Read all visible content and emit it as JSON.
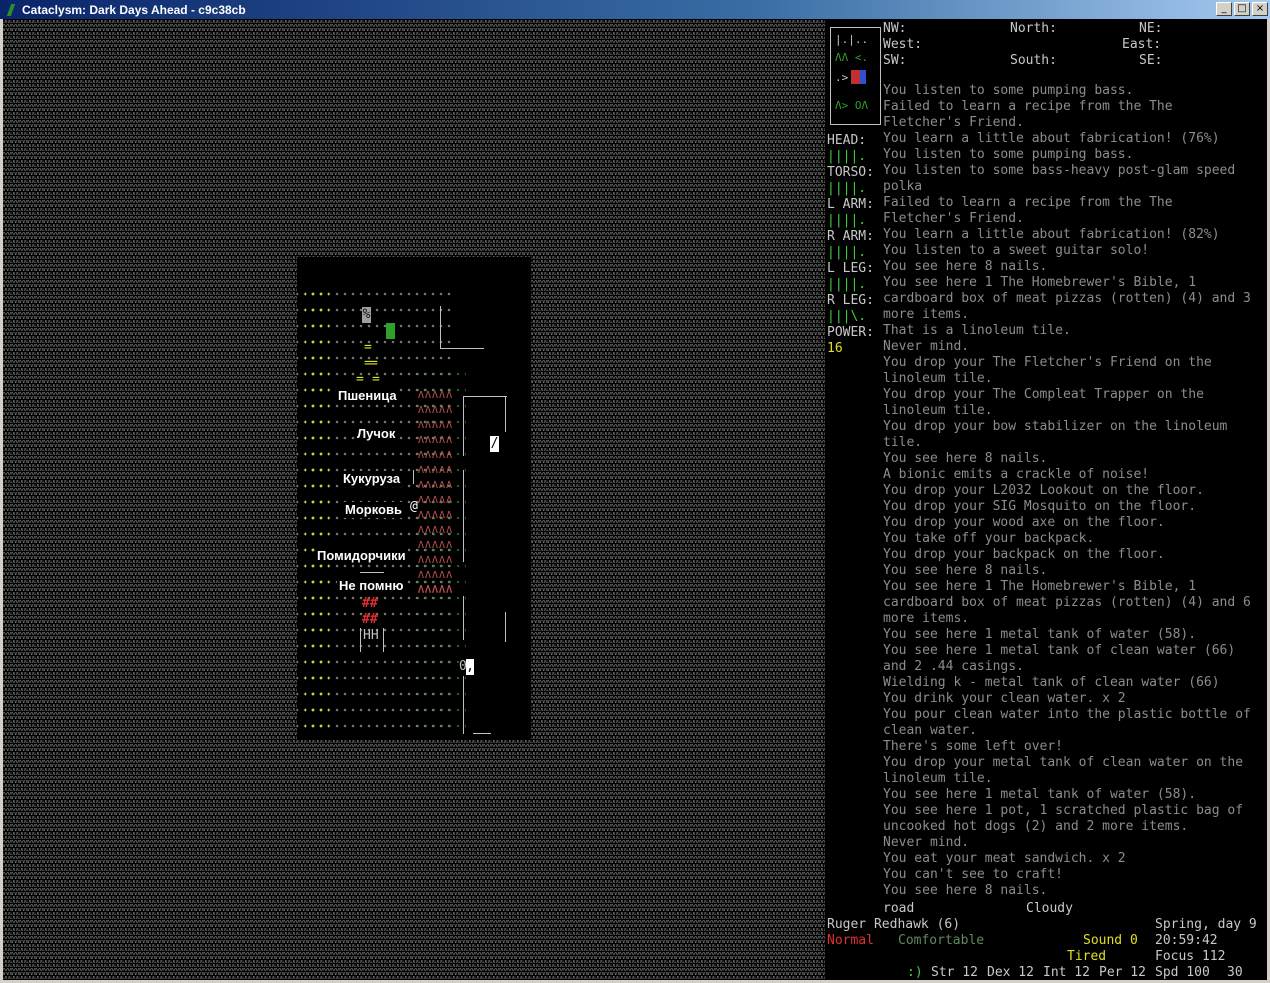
{
  "window": {
    "title": "Cataclysm: Dark Days Ahead - c9c38cb",
    "btn_min": "_",
    "btn_max": "□",
    "btn_close": "×"
  },
  "map": {
    "labels": {
      "wheat": "Пшеница",
      "onion": "Лучок",
      "corn": "Кукуруза",
      "carrot": "Морковь",
      "tomatoes": "Помидорчики",
      "forgot": "Не помню"
    },
    "player_glyph": "@",
    "crop_glyph": "ΛΛΛΛΛ",
    "door_glyph": "/",
    "bed_glyph": "HH",
    "fire_glyph": "##",
    "tank_glyph": "0",
    "item_glyph": ",",
    "shrub_glyph": "%",
    "eq_glyph": "="
  },
  "compass": {
    "nw": "NW:",
    "north": "North:",
    "ne": "NE:",
    "west": "West:",
    "east": "East:",
    "sw": "SW:",
    "south": "South:",
    "se": "SE:"
  },
  "minimap": {
    "r1": "|.|..",
    "r2": "ΛΛ <.",
    "r3": ".>.<.",
    "r4": "Λ> OΛ"
  },
  "body": {
    "head": "HEAD:",
    "head_bar": "||||.",
    "torso": "TORSO:",
    "torso_bar": "||||.",
    "larm": "L ARM:",
    "larm_bar": "||||.",
    "rarm": "R ARM:",
    "rarm_bar": "||||.",
    "lleg": "L LEG:",
    "lleg_bar": "||||.",
    "rleg": "R LEG:",
    "rleg_bar": "|||\\.",
    "power": "POWER:",
    "power_val": "16"
  },
  "messages": [
    "You listen to some pumping bass.",
    "Failed to learn a recipe from the The",
    "Fletcher's Friend.",
    "You learn a little about fabrication! (76%)",
    "You listen to some pumping bass.",
    "You listen to some bass-heavy post-glam speed",
    "polka",
    "Failed to learn a recipe from the The",
    "Fletcher's Friend.",
    "You learn a little about fabrication! (82%)",
    "You listen to a sweet guitar solo!",
    "You see here 8 nails.",
    "You see here 1 The Homebrewer's Bible, 1",
    "cardboard box of meat pizzas (rotten) (4) and 3",
    "more items.",
    "That is a linoleum tile.",
    "Never mind.",
    "You drop your The Fletcher's Friend on the",
    "linoleum tile.",
    "You drop your The Compleat Trapper on the",
    "linoleum tile.",
    "You drop your bow stabilizer on the linoleum",
    "tile.",
    "You see here 8 nails.",
    "A bionic emits a crackle of noise!",
    "You drop your L2032 Lookout on the floor.",
    "You drop your SIG Mosquito on the floor.",
    "You drop your wood axe on the floor.",
    "You take off your backpack.",
    "You drop your backpack on the floor.",
    "You see here 8 nails.",
    "You see here 1 The Homebrewer's Bible, 1",
    "cardboard box of meat pizzas (rotten) (4) and 6",
    "more items.",
    "You see here 1 metal tank of water (58).",
    "You see here 1 metal tank of clean water (66)",
    "and 2 .44 casings.",
    "Wielding k - metal tank of clean water (66)",
    "You drink your clean water. x 2",
    "You pour clean water into the plastic bottle of",
    "clean water.",
    "There's some left over!",
    "You drop your metal tank of clean water on the",
    "linoleum tile.",
    "You see here 1 metal tank of water (58).",
    "You see here 1 pot, 1 scratched plastic bag of",
    "uncooked hot dogs (2) and 2 more items.",
    "Never mind.",
    "You eat your meat sandwich. x 2",
    "You can't see to craft!",
    "You see here 8 nails."
  ],
  "status": {
    "terrain": "road",
    "weather": "Cloudy",
    "name": "Ruger Redhawk (6)",
    "date": "Spring, day 9",
    "mode": "Normal",
    "comfort": "Comfortable",
    "sound": "Sound 0",
    "time": "20:59:42",
    "fatigue": "Tired",
    "focus": "Focus 112",
    "morale": ":)",
    "str": "Str 12",
    "dex": "Dex 12",
    "int": "Int 12",
    "per": "Per 12",
    "spd": "Spd 100",
    "moves": "30"
  },
  "colors": {
    "hash": "#5a5a5a",
    "crop": "#c05050",
    "player": "#ffffff",
    "red": "#e03030",
    "green": "#2ea02e",
    "yellow": "#e0e020"
  }
}
